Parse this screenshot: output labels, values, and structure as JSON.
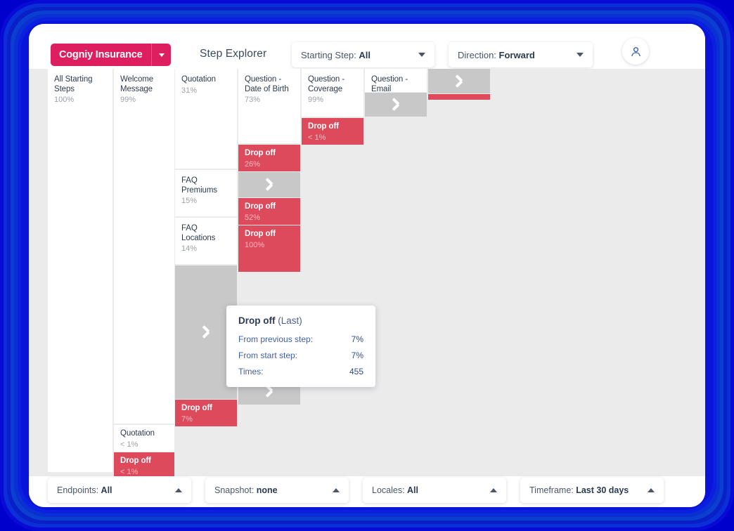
{
  "header": {
    "brand_label": "Cogniy Insurance",
    "brand_caret_icon": "chevron-down-icon",
    "page_title": "Step Explorer",
    "starting_step_prefix": "Starting Step: ",
    "starting_step_value": "All",
    "direction_prefix": "Direction: ",
    "direction_value": "Forward",
    "avatar_icon": "user-icon"
  },
  "chart_data": {
    "type": "table",
    "title": "Step Explorer",
    "columns": [
      {
        "index": 0,
        "nodes": [
          {
            "label": "All Starting Steps",
            "percent": "100%",
            "kind": "step"
          }
        ]
      },
      {
        "index": 1,
        "nodes": [
          {
            "label": "Welcome Message",
            "percent": "99%",
            "kind": "step"
          },
          {
            "label": "Quotation",
            "percent": "< 1%",
            "kind": "step"
          },
          {
            "label": "Drop off",
            "percent": "< 1%",
            "kind": "dropoff"
          }
        ]
      },
      {
        "index": 2,
        "nodes": [
          {
            "label": "Quotation",
            "percent": "31%",
            "kind": "step"
          },
          {
            "label": "FAQ Premiums",
            "percent": "15%",
            "kind": "step"
          },
          {
            "label": "FAQ Locations",
            "percent": "14%",
            "kind": "step"
          },
          {
            "label": "",
            "percent": "",
            "kind": "more"
          },
          {
            "label": "Drop off",
            "percent": "7%",
            "kind": "dropoff"
          }
        ]
      },
      {
        "index": 3,
        "nodes": [
          {
            "label": "Question - Date of Birth",
            "percent": "73%",
            "kind": "step"
          },
          {
            "label": "Drop off",
            "percent": "26%",
            "kind": "dropoff"
          },
          {
            "label": "",
            "percent": "",
            "kind": "more"
          },
          {
            "label": "Drop off",
            "percent": "52%",
            "kind": "dropoff"
          },
          {
            "label": "Drop off",
            "percent": "100%",
            "kind": "dropoff"
          },
          {
            "label": "",
            "percent": "",
            "kind": "more"
          }
        ]
      },
      {
        "index": 4,
        "nodes": [
          {
            "label": "Question - Coverage",
            "percent": "99%",
            "kind": "step"
          },
          {
            "label": "Drop off",
            "percent": "< 1%",
            "kind": "dropoff"
          }
        ]
      },
      {
        "index": 5,
        "nodes": [
          {
            "label": "Question - Email",
            "percent": "",
            "kind": "step"
          },
          {
            "label": "",
            "percent": "",
            "kind": "more"
          }
        ]
      },
      {
        "index": 6,
        "nodes": [
          {
            "label": "",
            "percent": "",
            "kind": "more"
          },
          {
            "label": "",
            "percent": "",
            "kind": "dropoff-bar"
          }
        ]
      }
    ],
    "colors": {
      "step": "#ffffff",
      "dropoff": "#dd4a5c",
      "more": "#c8c8c8",
      "canvas": "#ebebec",
      "brand": "#dd1f5f"
    }
  },
  "tooltip": {
    "title": "Drop off",
    "subtitle": "(Last)",
    "rows": [
      {
        "key": "From previous step:",
        "value": "7%"
      },
      {
        "key": "From start step:",
        "value": "7%"
      },
      {
        "key": "Times:",
        "value": "455"
      }
    ]
  },
  "footer": {
    "filters": [
      {
        "prefix": "Endpoints: ",
        "value": "All"
      },
      {
        "prefix": "Snapshot: ",
        "value": "none"
      },
      {
        "prefix": "Locales: ",
        "value": "All"
      },
      {
        "prefix": "Timeframe: ",
        "value": "Last 30 days"
      }
    ]
  }
}
